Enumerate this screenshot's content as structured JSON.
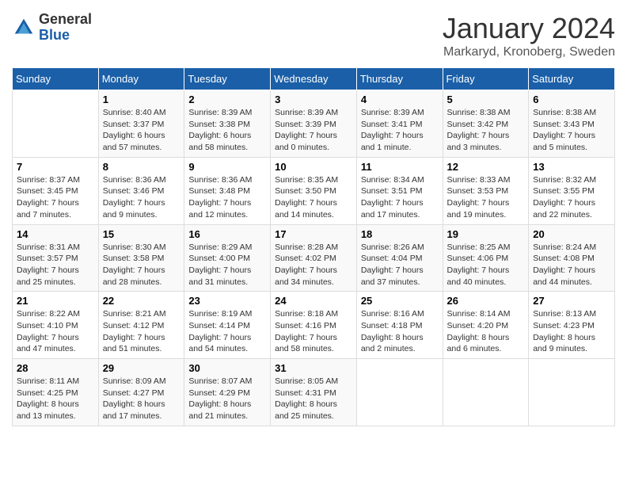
{
  "header": {
    "logo_general": "General",
    "logo_blue": "Blue",
    "month_title": "January 2024",
    "subtitle": "Markaryd, Kronoberg, Sweden"
  },
  "weekdays": [
    "Sunday",
    "Monday",
    "Tuesday",
    "Wednesday",
    "Thursday",
    "Friday",
    "Saturday"
  ],
  "weeks": [
    [
      {
        "day": "",
        "info": ""
      },
      {
        "day": "1",
        "info": "Sunrise: 8:40 AM\nSunset: 3:37 PM\nDaylight: 6 hours\nand 57 minutes."
      },
      {
        "day": "2",
        "info": "Sunrise: 8:39 AM\nSunset: 3:38 PM\nDaylight: 6 hours\nand 58 minutes."
      },
      {
        "day": "3",
        "info": "Sunrise: 8:39 AM\nSunset: 3:39 PM\nDaylight: 7 hours\nand 0 minutes."
      },
      {
        "day": "4",
        "info": "Sunrise: 8:39 AM\nSunset: 3:41 PM\nDaylight: 7 hours\nand 1 minute."
      },
      {
        "day": "5",
        "info": "Sunrise: 8:38 AM\nSunset: 3:42 PM\nDaylight: 7 hours\nand 3 minutes."
      },
      {
        "day": "6",
        "info": "Sunrise: 8:38 AM\nSunset: 3:43 PM\nDaylight: 7 hours\nand 5 minutes."
      }
    ],
    [
      {
        "day": "7",
        "info": "Sunrise: 8:37 AM\nSunset: 3:45 PM\nDaylight: 7 hours\nand 7 minutes."
      },
      {
        "day": "8",
        "info": "Sunrise: 8:36 AM\nSunset: 3:46 PM\nDaylight: 7 hours\nand 9 minutes."
      },
      {
        "day": "9",
        "info": "Sunrise: 8:36 AM\nSunset: 3:48 PM\nDaylight: 7 hours\nand 12 minutes."
      },
      {
        "day": "10",
        "info": "Sunrise: 8:35 AM\nSunset: 3:50 PM\nDaylight: 7 hours\nand 14 minutes."
      },
      {
        "day": "11",
        "info": "Sunrise: 8:34 AM\nSunset: 3:51 PM\nDaylight: 7 hours\nand 17 minutes."
      },
      {
        "day": "12",
        "info": "Sunrise: 8:33 AM\nSunset: 3:53 PM\nDaylight: 7 hours\nand 19 minutes."
      },
      {
        "day": "13",
        "info": "Sunrise: 8:32 AM\nSunset: 3:55 PM\nDaylight: 7 hours\nand 22 minutes."
      }
    ],
    [
      {
        "day": "14",
        "info": "Sunrise: 8:31 AM\nSunset: 3:57 PM\nDaylight: 7 hours\nand 25 minutes."
      },
      {
        "day": "15",
        "info": "Sunrise: 8:30 AM\nSunset: 3:58 PM\nDaylight: 7 hours\nand 28 minutes."
      },
      {
        "day": "16",
        "info": "Sunrise: 8:29 AM\nSunset: 4:00 PM\nDaylight: 7 hours\nand 31 minutes."
      },
      {
        "day": "17",
        "info": "Sunrise: 8:28 AM\nSunset: 4:02 PM\nDaylight: 7 hours\nand 34 minutes."
      },
      {
        "day": "18",
        "info": "Sunrise: 8:26 AM\nSunset: 4:04 PM\nDaylight: 7 hours\nand 37 minutes."
      },
      {
        "day": "19",
        "info": "Sunrise: 8:25 AM\nSunset: 4:06 PM\nDaylight: 7 hours\nand 40 minutes."
      },
      {
        "day": "20",
        "info": "Sunrise: 8:24 AM\nSunset: 4:08 PM\nDaylight: 7 hours\nand 44 minutes."
      }
    ],
    [
      {
        "day": "21",
        "info": "Sunrise: 8:22 AM\nSunset: 4:10 PM\nDaylight: 7 hours\nand 47 minutes."
      },
      {
        "day": "22",
        "info": "Sunrise: 8:21 AM\nSunset: 4:12 PM\nDaylight: 7 hours\nand 51 minutes."
      },
      {
        "day": "23",
        "info": "Sunrise: 8:19 AM\nSunset: 4:14 PM\nDaylight: 7 hours\nand 54 minutes."
      },
      {
        "day": "24",
        "info": "Sunrise: 8:18 AM\nSunset: 4:16 PM\nDaylight: 7 hours\nand 58 minutes."
      },
      {
        "day": "25",
        "info": "Sunrise: 8:16 AM\nSunset: 4:18 PM\nDaylight: 8 hours\nand 2 minutes."
      },
      {
        "day": "26",
        "info": "Sunrise: 8:14 AM\nSunset: 4:20 PM\nDaylight: 8 hours\nand 6 minutes."
      },
      {
        "day": "27",
        "info": "Sunrise: 8:13 AM\nSunset: 4:23 PM\nDaylight: 8 hours\nand 9 minutes."
      }
    ],
    [
      {
        "day": "28",
        "info": "Sunrise: 8:11 AM\nSunset: 4:25 PM\nDaylight: 8 hours\nand 13 minutes."
      },
      {
        "day": "29",
        "info": "Sunrise: 8:09 AM\nSunset: 4:27 PM\nDaylight: 8 hours\nand 17 minutes."
      },
      {
        "day": "30",
        "info": "Sunrise: 8:07 AM\nSunset: 4:29 PM\nDaylight: 8 hours\nand 21 minutes."
      },
      {
        "day": "31",
        "info": "Sunrise: 8:05 AM\nSunset: 4:31 PM\nDaylight: 8 hours\nand 25 minutes."
      },
      {
        "day": "",
        "info": ""
      },
      {
        "day": "",
        "info": ""
      },
      {
        "day": "",
        "info": ""
      }
    ]
  ]
}
